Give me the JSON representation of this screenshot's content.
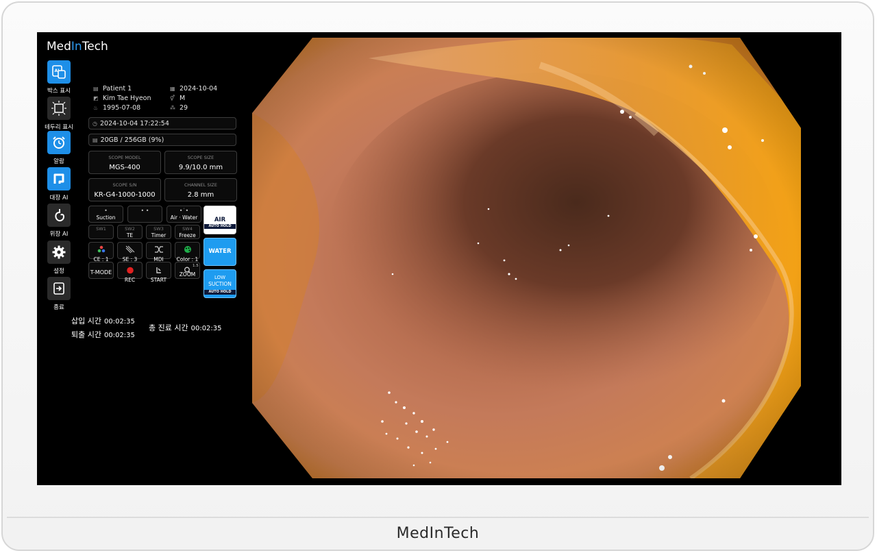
{
  "brand": {
    "logo_a": "Med",
    "logo_b": "In",
    "logo_c": "Tech",
    "bezel_label": "MedInTech",
    "accent": "#1e8fe8"
  },
  "sidebar": [
    {
      "label": "박스 표시",
      "icon": "ai-box-icon",
      "active": true
    },
    {
      "label": "테두리 표시",
      "icon": "border-frame-icon",
      "active": false
    },
    {
      "label": "알람",
      "icon": "alarm-clock-icon",
      "active": true
    },
    {
      "label": "대장 AI",
      "icon": "colon-icon",
      "active": true
    },
    {
      "label": "위장 AI",
      "icon": "stomach-icon",
      "active": false
    },
    {
      "label": "설정",
      "icon": "gear-icon",
      "active": false
    },
    {
      "label": "종료",
      "icon": "exit-icon",
      "active": false
    }
  ],
  "patient": {
    "name_label": "Patient 1",
    "name": "Kim Tae Hyeon",
    "birth": "1995-07-08",
    "exam_date": "2024-10-04",
    "sex": "M",
    "age": "29"
  },
  "status": {
    "datetime": "2024-10-04 17:22:54",
    "storage": "20GB / 256GB (9%)"
  },
  "scope": {
    "model_label": "SCOPE MODEL",
    "model": "MGS-400",
    "size_label": "SCOPE SIZE",
    "size": "9.9/10.0  mm",
    "sn_label": "SCOPE S/N",
    "sn": "KR-G4-1000-1000",
    "channel_label": "CHANNEL SIZE",
    "channel": "2.8  mm"
  },
  "controls": {
    "row1": [
      {
        "label": "Suction",
        "glyph": "•"
      },
      {
        "label": "",
        "glyph": "• •"
      },
      {
        "label": "Air · Water",
        "glyph": "•˙•"
      }
    ],
    "row2": [
      {
        "top": "SW1",
        "label": ""
      },
      {
        "top": "SW2",
        "label": "TE"
      },
      {
        "top": "SW3",
        "label": "Timer"
      },
      {
        "top": "SW4",
        "label": "Freeze"
      }
    ],
    "row3": [
      {
        "label": "CE : 1",
        "icon": "color-enhance-icon"
      },
      {
        "label": "SE : 3",
        "icon": "structure-enhance-icon"
      },
      {
        "label": "MDI",
        "icon": "shuffle-icon"
      },
      {
        "label": "Color : 1",
        "icon": "palette-icon"
      }
    ],
    "row4": [
      {
        "label": "T-MODE",
        "icon": ""
      },
      {
        "label": "REC",
        "icon": "record-icon"
      },
      {
        "label": "START",
        "icon": "start-icon"
      },
      {
        "label": "ZOOM",
        "icon": "zoom-icon",
        "badge": "1.5"
      }
    ]
  },
  "side_buttons": {
    "air": "AIR",
    "air_hold": "AUTO HOLD",
    "water": "WATER",
    "suction_a": "LOW",
    "suction_b": "SUCTION",
    "suction_hold": "AUTO HOLD"
  },
  "timers": {
    "insert_label": "삽입 시간",
    "insert_value": "00:02:35",
    "withdraw_label": "퇴출 시간",
    "withdraw_value": "00:02:35",
    "total_label": "총 진료 시간",
    "total_value": "00:02:35"
  }
}
